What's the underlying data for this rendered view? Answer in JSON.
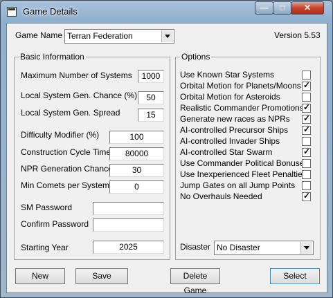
{
  "window": {
    "title": "Game Details",
    "min_icon": "minimize-icon",
    "max_icon": "maximize-icon",
    "close_icon": "close-icon",
    "min_glyph": "—",
    "max_glyph": "□",
    "close_glyph": "✕"
  },
  "header": {
    "game_name_label": "Game Name",
    "game_name_value": "Terran Federation",
    "version": "Version 5.53"
  },
  "basic": {
    "legend": "Basic Information",
    "fields": [
      {
        "label": "Maximum Number of Systems",
        "value": "1000"
      },
      {
        "label": "Local System Gen. Chance (%)",
        "value": "50"
      },
      {
        "label": "Local System Gen. Spread",
        "value": "15"
      },
      {
        "label": "Difficulty Modifier (%)",
        "value": "100"
      },
      {
        "label": "Construction Cycle Time",
        "value": "80000"
      },
      {
        "label": "NPR Generation Chance",
        "value": "30"
      },
      {
        "label": "Min Comets per System",
        "value": "0"
      },
      {
        "label": "SM Password",
        "value": ""
      },
      {
        "label": "Confirm Password",
        "value": ""
      },
      {
        "label": "Starting Year",
        "value": "2025"
      }
    ]
  },
  "options": {
    "legend": "Options",
    "items": [
      {
        "label": "Use Known Star Systems",
        "checked": false
      },
      {
        "label": "Orbital Motion for Planets/Moons",
        "checked": true
      },
      {
        "label": "Orbital Motion for Asteroids",
        "checked": false
      },
      {
        "label": "Realistic Commander Promotions",
        "checked": true
      },
      {
        "label": "Generate new races as NPRs",
        "checked": true
      },
      {
        "label": "AI-controlled Precursor Ships",
        "checked": true
      },
      {
        "label": "AI-controlled Invader Ships",
        "checked": false
      },
      {
        "label": "AI-controlled Star Swarm",
        "checked": true
      },
      {
        "label": "Use Commander Political Bonuses",
        "checked": false
      },
      {
        "label": "Use Inexperienced Fleet Penalties",
        "checked": false
      },
      {
        "label": "Jump Gates on all Jump Points",
        "checked": false
      },
      {
        "label": "No Overhauls Needed",
        "checked": true
      }
    ],
    "disaster_label": "Disaster",
    "disaster_value": "No Disaster"
  },
  "buttons": {
    "new": "New",
    "save": "Save",
    "delete": "Delete Game",
    "select": "Select"
  }
}
